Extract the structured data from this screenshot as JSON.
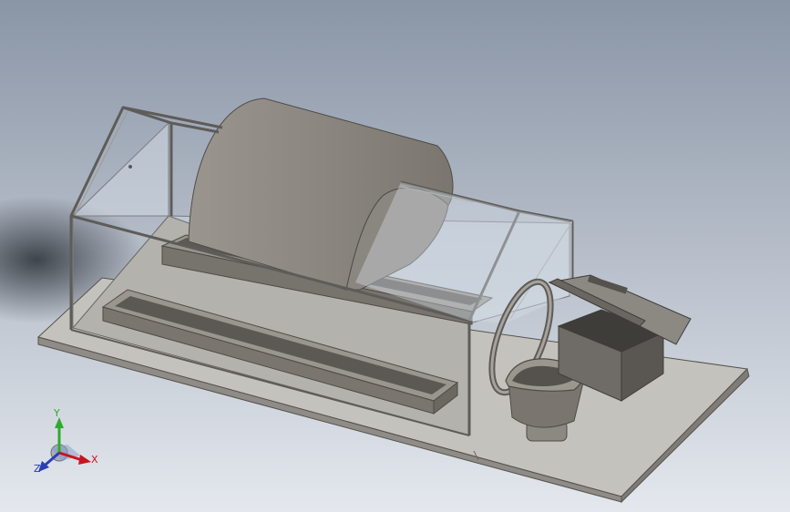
{
  "viewport": {
    "background_top": "#8a95a6",
    "background_bottom": "#e4e8ee"
  },
  "model": {
    "base_color": "#bfbdb8",
    "part_color": "#8e8a84",
    "frame_color": "#6f6d6a",
    "glass_color": "#d8e2ea"
  },
  "triad": {
    "x_label": "X",
    "y_label": "Y",
    "z_label": "Z",
    "x_color": "#c8141e",
    "y_color": "#2eab2e",
    "z_color": "#2a3fb5"
  }
}
